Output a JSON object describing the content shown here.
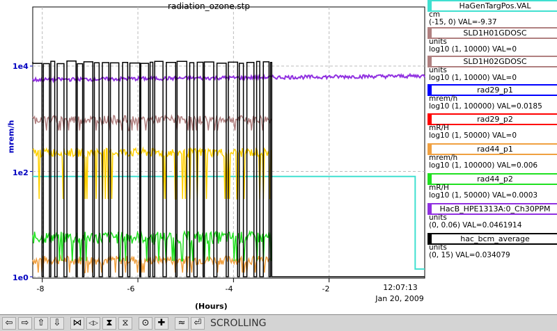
{
  "chart_data": {
    "type": "line",
    "title": "radiation_ozone.stp",
    "xlabel": "(Hours)",
    "ylabel": "mrem/h",
    "yscale": "log",
    "ylim": [
      1,
      10000
    ],
    "xlim": [
      -8.2,
      0
    ],
    "x_ticks": [
      "-8",
      "-6",
      "-4",
      "-2"
    ],
    "y_ticks": [
      "1e0",
      "1e2",
      "1e4"
    ],
    "grid": true,
    "series": [
      {
        "name": "HaGenTargPos.VAL",
        "color": "#40e0d0",
        "x": [
          -8.2,
          -0.2,
          -0.2,
          0
        ],
        "y": [
          80,
          80,
          1.4,
          1.4
        ]
      },
      {
        "name": "rad29_p1",
        "color": "#0000ff",
        "x": [],
        "y": []
      },
      {
        "name": "rad29_p2",
        "color": "#ff0000",
        "x": [],
        "y": []
      },
      {
        "name": "rad44_p1",
        "color": "#f0a040",
        "x": [
          -8.2,
          -3.2
        ],
        "y": [
          2,
          2
        ]
      },
      {
        "name": "rad44_p2",
        "color": "#20e020",
        "x": [
          -8.2,
          -3.2
        ],
        "y": [
          6,
          6
        ]
      },
      {
        "name": "HacB_HPE1313A:0_Ch30PPM",
        "color": "#9030e0",
        "x": [
          -8.2,
          -4,
          0
        ],
        "y": [
          5500,
          6000,
          6500
        ]
      },
      {
        "name": "hac_bcm_average",
        "color": "#000000",
        "x": [
          -8.2,
          -3.2,
          -3.2,
          0
        ],
        "y": [
          12000,
          12000,
          1,
          1
        ]
      },
      {
        "name": "SLD1H01GDOSC",
        "color": "#b08080",
        "x": [
          -8.2,
          -3.2
        ],
        "y": [
          1000,
          1000
        ]
      },
      {
        "name": "SLD1H02GDOSC",
        "color": "#ffd000",
        "x": [
          -8.2,
          -3.2
        ],
        "y": [
          250,
          250
        ]
      }
    ]
  },
  "plot": {
    "time": "12:07:13",
    "date": "Jan 20, 2009"
  },
  "legend": [
    {
      "name": "HaGenTargPos.VAL",
      "color": "#40e0d0",
      "unit": "cm",
      "range": "(-15, 0) VAL=-9.37"
    },
    {
      "name": "SLD1H01GDOSC",
      "color": "#b08080",
      "unit": "units",
      "range": "log10 (1, 10000) VAL=0"
    },
    {
      "name": "SLD1H02GDOSC",
      "color": "#b08080",
      "unit": "units",
      "range": "log10 (1, 10000) VAL=0"
    },
    {
      "name": "rad29_p1",
      "color": "#0000ff",
      "unit": "mrem/h",
      "range": "log10 (1, 100000) VAL=0.0185"
    },
    {
      "name": "rad29_p2",
      "color": "#ff0000",
      "unit": "mR/H",
      "range": "log10 (1, 50000) VAL=0"
    },
    {
      "name": "rad44_p1",
      "color": "#f0a040",
      "unit": "mrem/h",
      "range": "log10 (1, 100000) VAL=0.006"
    },
    {
      "name": "rad44_p2",
      "color": "#20e020",
      "unit": "mR/H",
      "range": "log10 (1, 50000) VAL=0.0003"
    },
    {
      "name": "HacB_HPE1313A:0_Ch30PPM",
      "color": "#9030e0",
      "unit": "units",
      "range": "(0, 0.06) VAL=0.0461914"
    },
    {
      "name": "hac_bcm_average",
      "color": "#000000",
      "unit": "units",
      "range": "(0, 15) VAL=0.034079"
    }
  ],
  "toolbar": {
    "buttons": [
      {
        "name": "scroll-left-button",
        "glyph": "⇦"
      },
      {
        "name": "scroll-right-button",
        "glyph": "⇨"
      },
      {
        "name": "scroll-up-button",
        "glyph": "⇧"
      },
      {
        "name": "scroll-down-button",
        "glyph": "⇩"
      },
      {
        "name": "compress-x-button",
        "glyph": "⋈"
      },
      {
        "name": "expand-x-button",
        "glyph": "◁▷"
      },
      {
        "name": "compress-y-button",
        "glyph": "⧗"
      },
      {
        "name": "expand-y-button",
        "glyph": "⧖"
      },
      {
        "name": "zoom-out-button",
        "glyph": "⊙"
      },
      {
        "name": "zoom-in-button",
        "glyph": "✚"
      },
      {
        "name": "autoscale-button",
        "glyph": "≈"
      },
      {
        "name": "back-to-scroll-button",
        "glyph": "⏎"
      }
    ],
    "mode_label": "SCROLLING"
  }
}
